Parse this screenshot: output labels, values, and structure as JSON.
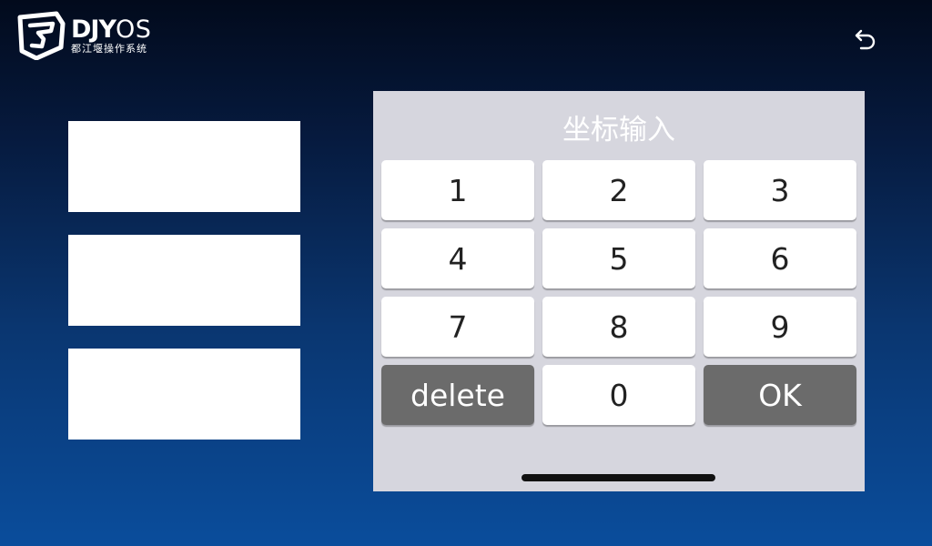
{
  "header": {
    "logo_name_bold": "DJY",
    "logo_name_thin": "OS",
    "logo_subtitle": "都江堰操作系统",
    "back_icon": "back-arrow-icon"
  },
  "fields": [
    {
      "value": ""
    },
    {
      "value": ""
    },
    {
      "value": ""
    }
  ],
  "keypad": {
    "title": "坐标输入",
    "keys": {
      "k1": "1",
      "k2": "2",
      "k3": "3",
      "k4": "4",
      "k5": "5",
      "k6": "6",
      "k7": "7",
      "k8": "8",
      "k9": "9",
      "delete": "delete",
      "k0": "0",
      "ok": "OK"
    }
  },
  "colors": {
    "panel_bg": "#d6d6de",
    "key_bg": "#ffffff",
    "action_key_bg": "#6b6b6b",
    "background_top": "#020a1c",
    "background_bottom": "#0a4d9c"
  }
}
